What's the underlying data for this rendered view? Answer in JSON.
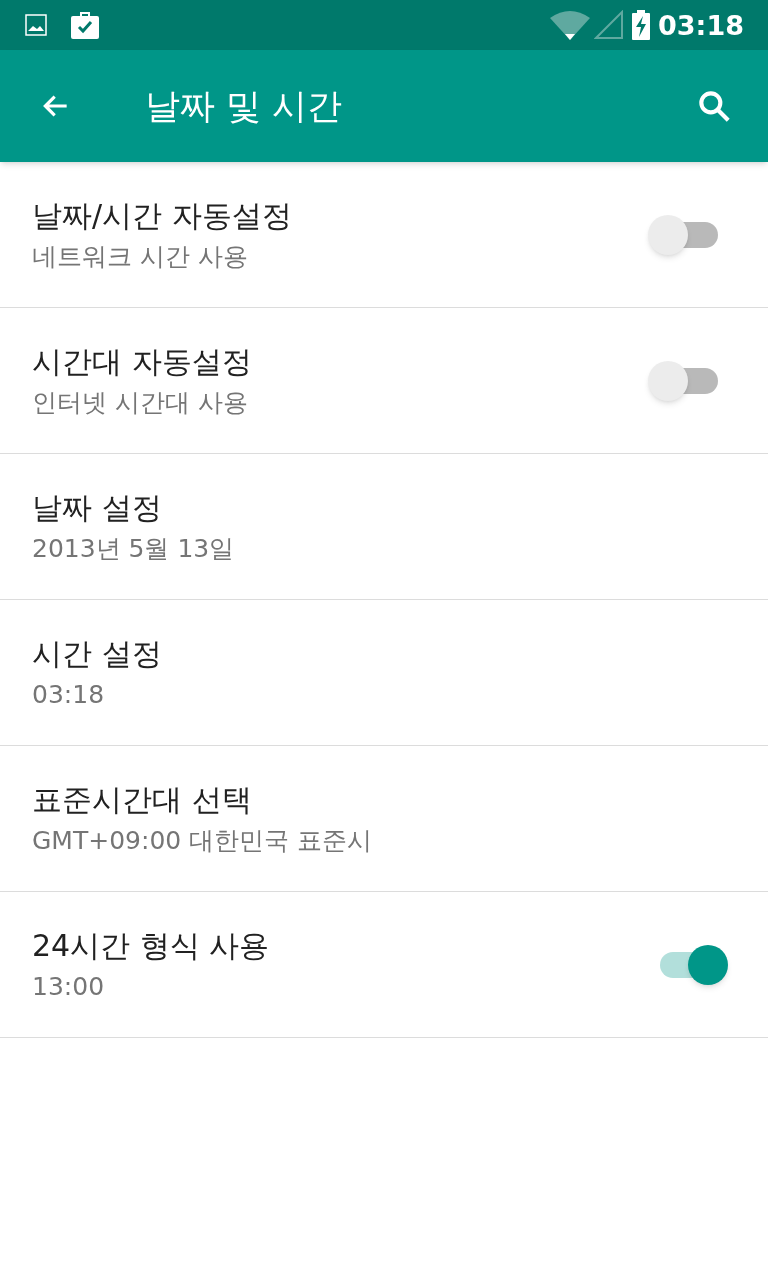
{
  "status_bar": {
    "time": "03:18"
  },
  "app_bar": {
    "title": "날짜 및 시간"
  },
  "settings": [
    {
      "kind": "switch",
      "title": "날짜/시간 자동설정",
      "summary": "네트워크 시간 사용",
      "on": false
    },
    {
      "kind": "switch",
      "title": "시간대 자동설정",
      "summary": "인터넷 시간대 사용",
      "on": false
    },
    {
      "kind": "plain",
      "title": "날짜 설정",
      "summary": "2013년 5월 13일"
    },
    {
      "kind": "plain",
      "title": "시간 설정",
      "summary": "03:18"
    },
    {
      "kind": "plain",
      "title": "표준시간대 선택",
      "summary": "GMT+09:00 대한민국 표준시"
    },
    {
      "kind": "switch",
      "title": "24시간 형식 사용",
      "summary": "13:00",
      "on": true
    }
  ]
}
